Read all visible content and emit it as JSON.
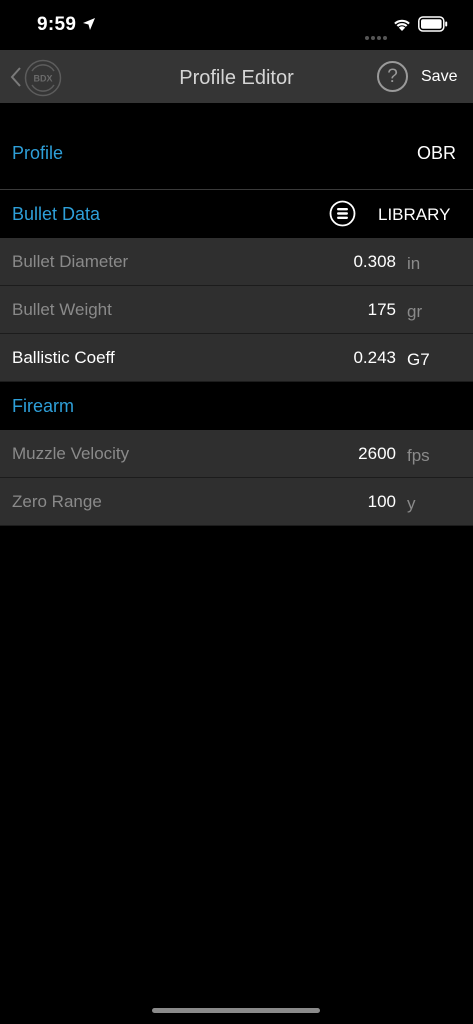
{
  "status": {
    "time": "9:59"
  },
  "nav": {
    "logo_text": "BDX",
    "title": "Profile Editor",
    "help_label": "?",
    "save_label": "Save"
  },
  "profile": {
    "label": "Profile",
    "value": "OBR"
  },
  "bullet_data": {
    "label": "Bullet Data",
    "library_label": "LIBRARY",
    "rows": [
      {
        "label": "Bullet Diameter",
        "value": "0.308",
        "unit": "in"
      },
      {
        "label": "Bullet Weight",
        "value": "175",
        "unit": "gr"
      },
      {
        "label": "Ballistic Coeff",
        "value": "0.243",
        "unit": "G7"
      }
    ]
  },
  "firearm": {
    "label": "Firearm",
    "rows": [
      {
        "label": "Muzzle Velocity",
        "value": "2600",
        "unit": "fps"
      },
      {
        "label": "Zero Range",
        "value": "100",
        "unit": "y"
      }
    ]
  },
  "colors": {
    "accent": "#2e9fd8",
    "row_bg": "#2f2f2f",
    "nav_bg": "#353535"
  }
}
